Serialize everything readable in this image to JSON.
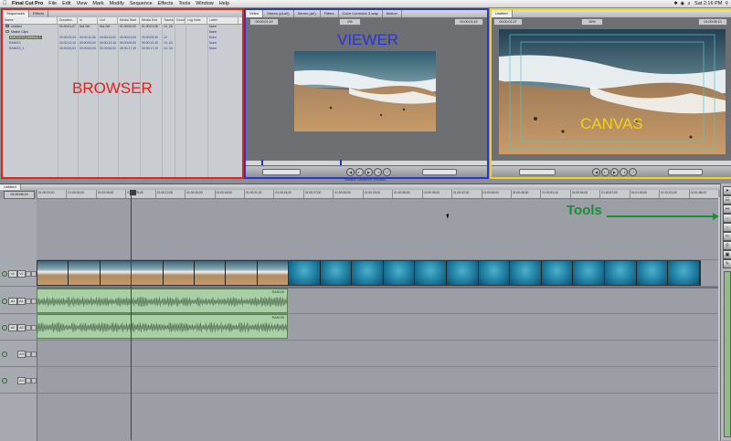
{
  "menubar": {
    "apple": "",
    "app": "Final Cut Pro",
    "items": [
      "File",
      "Edit",
      "View",
      "Mark",
      "Modify",
      "Sequence",
      "Effects",
      "Tools",
      "Window",
      "Help"
    ],
    "clock": "Sat 2:16 PM"
  },
  "browser": {
    "label": "BROWSER",
    "tabs": [
      "Sequences",
      "Effects"
    ],
    "columns": [
      "Name",
      "Duration",
      "In",
      "Out",
      "Media Start",
      "Media End",
      "Tracks",
      "Good",
      "Log Note",
      "Label"
    ],
    "rows": [
      {
        "name": "Untitled",
        "duration": "00:00:01;07",
        "in": "Not Set",
        "out": "Not Set",
        "mstart": "01:00:00;00",
        "mend": "01:00:01;06",
        "tracks": "1V, 2A",
        "label": "None"
      },
      {
        "name": "Master Clips",
        "duration": "",
        "in": "",
        "out": "",
        "mstart": "",
        "mend": "",
        "tracks": "",
        "label": "None"
      },
      {
        "name": "KMGO013 (Untitled) 1",
        "duration": "00:00:02;24",
        "in": "00:00:11;05",
        "out": "00:00:14;00",
        "mstart": "00:00:01;05",
        "mend": "00:00:05;20",
        "tracks": "1V",
        "label": "None"
      },
      {
        "name": "RANVIS",
        "duration": "00:00:12;15",
        "in": "00:00:00;00",
        "out": "00:00:12;15",
        "mstart": "00:00:00;00",
        "mend": "00:00:12;15",
        "tracks": "1V, 2A",
        "label": "None"
      },
      {
        "name": "RANVIS_1",
        "duration": "00:00:06;03",
        "in": "00:00:00;00",
        "out": "00:00:06;03",
        "mstart": "00:00:17;19",
        "mend": "00:00:17;19",
        "tracks": "1V, 2A",
        "label": "None"
      }
    ]
  },
  "viewer": {
    "label": "VIEWER",
    "tabs": [
      "Video",
      "Stereo (a1a2)",
      "Stereo (a2)",
      "Filters",
      "Color Corrector 3-way",
      "Motion"
    ],
    "timecode_in": "00:00:01;19",
    "timecode_out": "00:00:01;19",
    "zoom": "0%",
    "status": "Timeline: Untitled in Transitio"
  },
  "canvas": {
    "label": "CANVAS",
    "tabs": [
      "Untitled"
    ],
    "timecode_in": "00:00:01;27",
    "timecode_out": "01:00:09;13",
    "zoom": "30%"
  },
  "timeline": {
    "tab": "Untitled",
    "timecode": "01:00:06;13",
    "ruler": [
      "01:00:00;00",
      "01:00:03;00",
      "01:00:06;00",
      "01:00:09;00",
      "01:00:12;00",
      "01:00:15;00",
      "01:00:18;00",
      "01:00:21;00",
      "01:00:24;00",
      "01:00:27;00",
      "01:00:30;00",
      "01:00:33;00",
      "01:00:36;00",
      "01:00:39;00",
      "01:00:42;00",
      "01:00:45;00",
      "01:00:48;00",
      "01:00:51;00",
      "01:00:54;00",
      "01:00:57;00",
      "01:01:00;00",
      "01:01:03;00",
      "01:01:06;00"
    ],
    "tracks": [
      {
        "id": "v1",
        "label": "V1",
        "src": "v1"
      },
      {
        "id": "a1",
        "label": "A1",
        "src": "a1"
      },
      {
        "id": "a2",
        "label": "A2",
        "src": "a2"
      },
      {
        "id": "a3",
        "label": "A3",
        "src": ""
      },
      {
        "id": "a4",
        "label": "A4",
        "src": ""
      }
    ],
    "audio_clip_label": "RANVIS"
  },
  "annotations": {
    "tools_label": "Tools"
  },
  "colors": {
    "browser_frame": "#e2231a",
    "viewer_frame": "#2a35d6",
    "canvas_frame": "#f1d21a",
    "tools_label": "#1d8b3b",
    "audio_clip": "#a8cfa6"
  }
}
